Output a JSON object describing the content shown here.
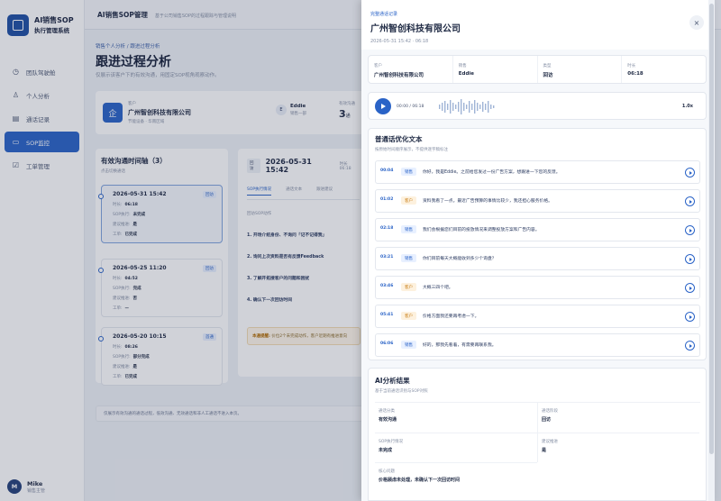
{
  "brand": {
    "title": "AI销售SOP",
    "subtitle": "执行管理系统"
  },
  "nav": [
    {
      "label": "团队驾驶舱",
      "icon": "dashboard-icon",
      "glyph": "◷"
    },
    {
      "label": "个人分析",
      "icon": "person-icon",
      "glyph": "♙"
    },
    {
      "label": "通话记录",
      "icon": "document-icon",
      "glyph": "▤"
    },
    {
      "label": "SOP监控",
      "icon": "monitor-icon",
      "glyph": "▭",
      "active": true
    },
    {
      "label": "工单管理",
      "icon": "ticket-icon",
      "glyph": "☑"
    }
  ],
  "user": {
    "initial": "M",
    "name": "Mike",
    "role": "销售主管"
  },
  "topbar": {
    "title": "AI销售SOP管理",
    "subtitle": "基于公司销售SOP的过程跟踪与管理说明"
  },
  "breadcrumb": "销售个人分析 / 跟进过程分析",
  "page": {
    "title": "跟进过程分析",
    "subtitle": "仅展示该客户下的有效沟通，用固定SOP视角观察动作。"
  },
  "customer": {
    "logo": "企",
    "label": "客户",
    "name": "广州智创科技有限公司",
    "meta": "节能设备 · 华南区域",
    "rep_initial": "E",
    "rep_name": "Eddie",
    "rep_sub": "销售一部",
    "count_label": "有效沟通",
    "count_value": "3",
    "count_unit": "通"
  },
  "timeline": {
    "title": "有效沟通时间轴（3）",
    "subtitle": "点击切换通话",
    "records": [
      {
        "date": "2026-05-31 15:42",
        "tag": "回访",
        "rows": [
          [
            "时长:",
            "06:18"
          ],
          [
            "SOP执行:",
            "未完成"
          ],
          [
            "建议推进:",
            "是"
          ],
          [
            "工单:",
            "已完成"
          ]
        ]
      },
      {
        "date": "2026-05-25 11:20",
        "tag": "回访",
        "rows": [
          [
            "时长:",
            "04:52"
          ],
          [
            "SOP执行:",
            "完成"
          ],
          [
            "建议推进:",
            "否"
          ],
          [
            "工单:",
            "—"
          ]
        ]
      },
      {
        "date": "2026-05-20 10:15",
        "tag": "首通",
        "rows": [
          [
            "时长:",
            "08:26"
          ],
          [
            "SOP执行:",
            "部分完成"
          ],
          [
            "建议推进:",
            "是"
          ],
          [
            "工单:",
            "已完成"
          ]
        ]
      }
    ]
  },
  "detail": {
    "badge": "回访",
    "date": "2026-05-31 15:42",
    "duration": "时长 06:18",
    "tabs": [
      "SOP执行情况",
      "通话文本",
      "跟进建议"
    ],
    "section": "回访SOP动作",
    "steps": [
      "1. 开场介绍身份、不询问「记不记得我」",
      "2. 询问上次资料是否有反馈Feedback",
      "3. 了解开拓搜客户的问题和困扰",
      "4. 确认下一次回访时间"
    ],
    "note_label": "本通提醒:",
    "note_text": "价位2个未完成动作，客户近期有推进意向"
  },
  "hint": "仅展示有效沟通的通话过程，低效沟通、无效通话和非人工通话不进入本页。",
  "drawer": {
    "kicker": "完整通话记录",
    "title": "广州智创科技有限公司",
    "time": "2026-05-31 15:42 · 06:18",
    "info": [
      {
        "label": "客户",
        "value": "广州智创科技有限公司"
      },
      {
        "label": "销售",
        "value": "Eddie"
      },
      {
        "label": "类型",
        "value": "回访"
      },
      {
        "label": "时长",
        "value": "06:18"
      }
    ],
    "player": {
      "time": "00:00 / 06:18",
      "speed": "1.0x"
    },
    "transcript_title": "普通话优化文本",
    "transcript_subtitle": "按原始时间顺序展示，不提供逐字稿标注",
    "transcript": [
      {
        "time": "00:04",
        "role": "销售",
        "kind": "sales",
        "text": "你好，我是Eddie。之前给您发过一份广告方案，想跟进一下您的反馈。"
      },
      {
        "time": "01:02",
        "role": "客户",
        "kind": "cust",
        "text": "资料我看了一点。最近广告预算的事情比较少，我还担心服务价格。"
      },
      {
        "time": "02:18",
        "role": "销售",
        "kind": "sales",
        "text": "我们会根据您们目前的投放情况来调整投放方案和广告内容。"
      },
      {
        "time": "03:21",
        "role": "销售",
        "kind": "sales",
        "text": "你们目前每天大概能收到多少个询盘？"
      },
      {
        "time": "03:46",
        "role": "客户",
        "kind": "cust",
        "text": "大概三四个吧。"
      },
      {
        "time": "05:41",
        "role": "客户",
        "kind": "cust",
        "text": "价格方面我还要再考虑一下。"
      },
      {
        "time": "06:06",
        "role": "销售",
        "kind": "sales",
        "text": "好的，那我先看着，有需要再联系我。"
      }
    ],
    "ai_title": "AI分析结果",
    "ai_subtitle": "基于当前通话识别与SOP对照",
    "ai": [
      {
        "label": "通话分类",
        "value": "有效沟通"
      },
      {
        "label": "通话阶段",
        "value": "回访"
      },
      {
        "label": "SOP执行情况",
        "value": "未完成"
      },
      {
        "label": "建议推进",
        "value": "是"
      },
      {
        "label": "核心问题",
        "value": "价格顾虑未处理，未确认下一次回访时间"
      }
    ]
  }
}
